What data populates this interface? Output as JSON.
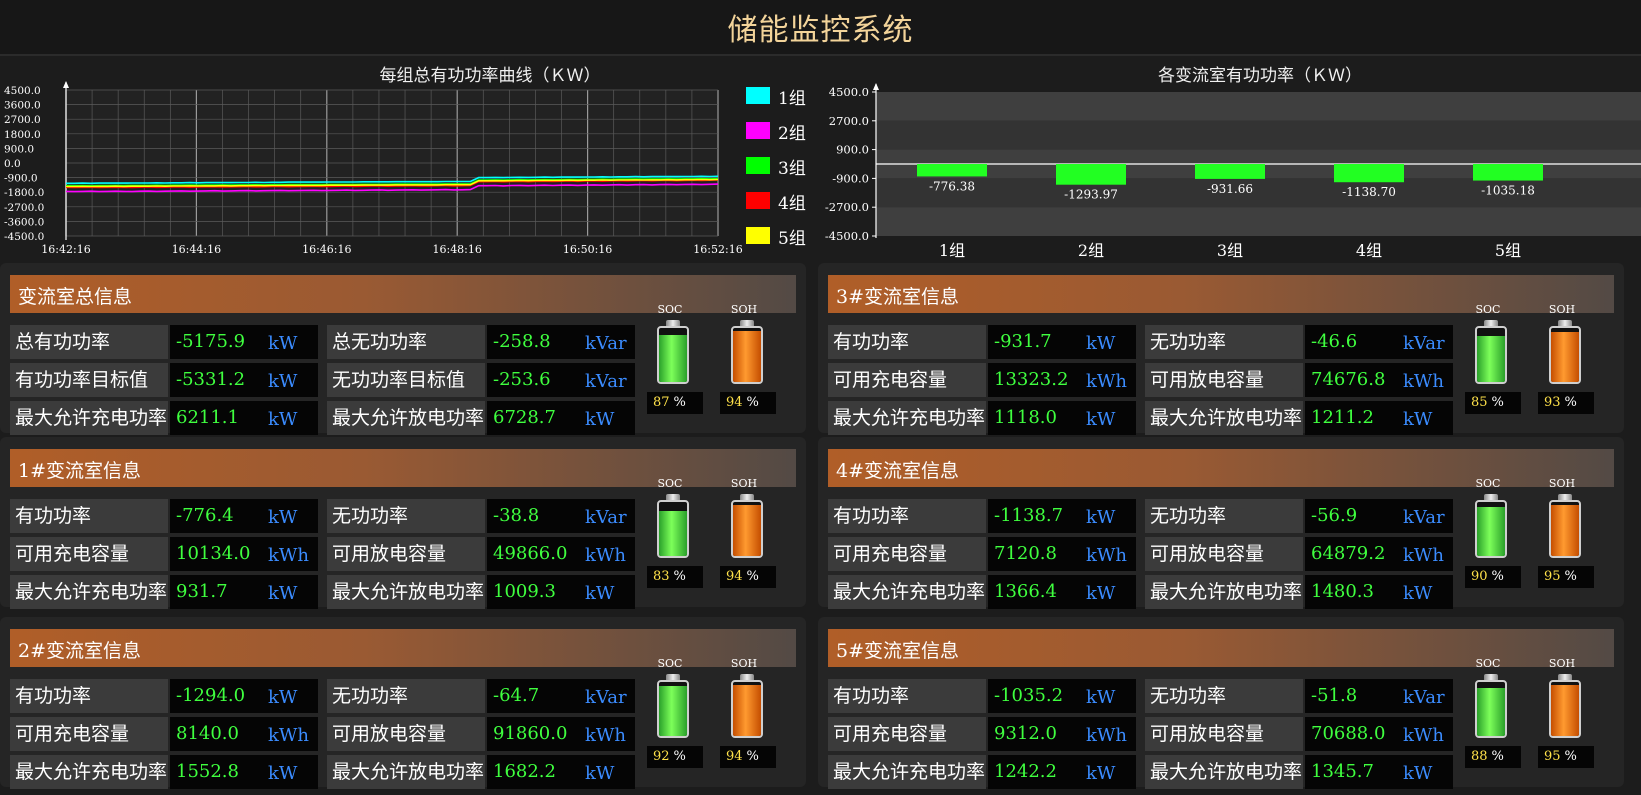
{
  "app_title": "储能监控系统",
  "line_chart": {
    "title": "每组总有功功率曲线（ＫＷ）",
    "legend": [
      {
        "label": "1组",
        "color": "#00ffff"
      },
      {
        "label": "2组",
        "color": "#ff00ff"
      },
      {
        "label": "3组",
        "color": "#00ff00"
      },
      {
        "label": "4组",
        "color": "#ff0000"
      },
      {
        "label": "5组",
        "color": "#ffff00"
      }
    ]
  },
  "bar_chart": {
    "title": "各变流室有功功率（ＫＷ）"
  },
  "chart_data": [
    {
      "type": "line",
      "title": "每组总有功功率曲线（ＫＷ）",
      "x_ticks": [
        "16:42:16",
        "16:44:16",
        "16:46:16",
        "16:48:16",
        "16:50:16",
        "16:52:16"
      ],
      "y_ticks": [
        "4500.0",
        "3600.0",
        "2700.0",
        "1800.0",
        "900.0",
        "0.0",
        "-900.0",
        "-1800.0",
        "-2700.0",
        "-3600.0",
        "-4500.0"
      ],
      "ylim": [
        -4500,
        4500
      ],
      "series": [
        {
          "name": "1组",
          "color": "#00ffff",
          "values": [
            -1250,
            -1250,
            -1240,
            -1250,
            -1240,
            -1240,
            -1230,
            -1240,
            -1230,
            -1230,
            -1230,
            -1220,
            -1230,
            -1220,
            -1220,
            -1210,
            -1220,
            -1210,
            -1210,
            -1200,
            -1210,
            -1200,
            -1200,
            -1190,
            -1200,
            -1190,
            -1190,
            -1180,
            -1180,
            -1180,
            -1180,
            -1180,
            -1170,
            -1170,
            -1170,
            -1170,
            -1160,
            -1160,
            -1160,
            -1160,
            -1150,
            -1150,
            -1150,
            -1150,
            -1150,
            -1150,
            -1140,
            -1140,
            -1140,
            -1140,
            -900,
            -900,
            -890,
            -900,
            -890,
            -880,
            -890,
            -880,
            -870,
            -880,
            -870,
            -860,
            -870,
            -860,
            -860,
            -850,
            -860,
            -850,
            -850,
            -840,
            -850,
            -840,
            -840,
            -830,
            -840,
            -830,
            -830,
            -820,
            -830,
            -820
          ]
        },
        {
          "name": "2组",
          "color": "#ff00ff",
          "values": [
            -1750,
            -1760,
            -1750,
            -1740,
            -1760,
            -1750,
            -1740,
            -1750,
            -1760,
            -1740,
            -1730,
            -1750,
            -1740,
            -1730,
            -1720,
            -1740,
            -1730,
            -1720,
            -1710,
            -1730,
            -1720,
            -1710,
            -1700,
            -1720,
            -1710,
            -1700,
            -1690,
            -1710,
            -1700,
            -1690,
            -1680,
            -1700,
            -1690,
            -1680,
            -1670,
            -1690,
            -1680,
            -1670,
            -1660,
            -1680,
            -1670,
            -1660,
            -1650,
            -1670,
            -1660,
            -1650,
            -1640,
            -1660,
            -1650,
            -1640,
            -1400,
            -1400,
            -1390,
            -1410,
            -1390,
            -1380,
            -1400,
            -1380,
            -1370,
            -1390,
            -1370,
            -1360,
            -1380,
            -1360,
            -1350,
            -1370,
            -1350,
            -1340,
            -1360,
            -1340,
            -1330,
            -1350,
            -1330,
            -1320,
            -1340,
            -1320,
            -1310,
            -1330,
            -1310,
            -1300
          ]
        },
        {
          "name": "3组",
          "color": "#00ff00",
          "values": [
            -1400,
            -1400,
            -1390,
            -1400,
            -1390,
            -1390,
            -1380,
            -1390,
            -1380,
            -1380,
            -1380,
            -1370,
            -1380,
            -1370,
            -1370,
            -1360,
            -1370,
            -1360,
            -1360,
            -1350,
            -1360,
            -1350,
            -1350,
            -1340,
            -1350,
            -1340,
            -1340,
            -1330,
            -1330,
            -1330,
            -1330,
            -1330,
            -1320,
            -1320,
            -1320,
            -1320,
            -1310,
            -1310,
            -1310,
            -1310,
            -1300,
            -1300,
            -1300,
            -1300,
            -1300,
            -1300,
            -1290,
            -1290,
            -1290,
            -1290,
            -1050,
            -1050,
            -1040,
            -1050,
            -1040,
            -1030,
            -1040,
            -1030,
            -1020,
            -1030,
            -1020,
            -1010,
            -1020,
            -1010,
            -1010,
            -1000,
            -1010,
            -1000,
            -1000,
            -990,
            -1000,
            -990,
            -990,
            -980,
            -990,
            -980,
            -980,
            -970,
            -980,
            -970
          ]
        },
        {
          "name": "4组",
          "color": "#ff0000",
          "values": [
            -1500,
            -1510,
            -1500,
            -1490,
            -1510,
            -1500,
            -1490,
            -1500,
            -1510,
            -1490,
            -1480,
            -1500,
            -1490,
            -1480,
            -1470,
            -1490,
            -1480,
            -1470,
            -1460,
            -1480,
            -1470,
            -1460,
            -1450,
            -1470,
            -1460,
            -1450,
            -1440,
            -1460,
            -1450,
            -1440,
            -1430,
            -1450,
            -1440,
            -1430,
            -1420,
            -1440,
            -1430,
            -1420,
            -1410,
            -1430,
            -1420,
            -1410,
            -1400,
            -1420,
            -1410,
            -1400,
            -1390,
            -1410,
            -1400,
            -1390,
            -1150,
            -1150,
            -1140,
            -1160,
            -1140,
            -1130,
            -1150,
            -1130,
            -1120,
            -1140,
            -1120,
            -1110,
            -1130,
            -1110,
            -1100,
            -1120,
            -1100,
            -1090,
            -1110,
            -1090,
            -1080,
            -1100,
            -1080,
            -1070,
            -1090,
            -1070,
            -1060,
            -1080,
            -1060,
            -1050
          ]
        },
        {
          "name": "5组",
          "color": "#ffff00",
          "values": [
            -1450,
            -1450,
            -1440,
            -1450,
            -1440,
            -1440,
            -1430,
            -1440,
            -1430,
            -1430,
            -1430,
            -1420,
            -1430,
            -1420,
            -1420,
            -1410,
            -1420,
            -1410,
            -1410,
            -1400,
            -1410,
            -1400,
            -1400,
            -1390,
            -1400,
            -1390,
            -1390,
            -1380,
            -1380,
            -1380,
            -1380,
            -1380,
            -1370,
            -1370,
            -1370,
            -1370,
            -1360,
            -1360,
            -1360,
            -1360,
            -1350,
            -1350,
            -1350,
            -1350,
            -1350,
            -1350,
            -1340,
            -1340,
            -1340,
            -1340,
            -1100,
            -1100,
            -1090,
            -1100,
            -1090,
            -1080,
            -1090,
            -1080,
            -1070,
            -1080,
            -1070,
            -1060,
            -1070,
            -1060,
            -1060,
            -1050,
            -1060,
            -1050,
            -1050,
            -1040,
            -1050,
            -1040,
            -1040,
            -1030,
            -1040,
            -1030,
            -1030,
            -1020,
            -1030,
            -1020
          ]
        }
      ]
    },
    {
      "type": "bar",
      "title": "各变流室有功功率（ＫＷ）",
      "categories": [
        "1组",
        "2组",
        "3组",
        "4组",
        "5组"
      ],
      "values": [
        -776.38,
        -1293.97,
        -931.66,
        -1138.7,
        -1035.18
      ],
      "value_labels": [
        "-776.38",
        "-1293.97",
        "-931.66",
        "-1138.70",
        "-1035.18"
      ],
      "y_ticks": [
        "4500.0",
        "2700.0",
        "900.0",
        "-900.0",
        "-2700.0",
        "-4500.0"
      ],
      "ylim": [
        -4500,
        4500
      ],
      "bar_color": "#22ff22"
    }
  ],
  "panels": [
    {
      "title": "变流室总信息",
      "rows": [
        {
          "l_label": "总有功功率",
          "l_value": "-5175.9",
          "l_unit": "kW",
          "r_label": "总无功功率",
          "r_value": "-258.8",
          "r_unit": "kVar"
        },
        {
          "l_label": "有功功率目标值",
          "l_value": "-5331.2",
          "l_unit": "kW",
          "r_label": "无功功率目标值",
          "r_value": "-253.6",
          "r_unit": "kVar"
        },
        {
          "l_label": "最大允许充电功率",
          "l_value": "6211.1",
          "l_unit": "kW",
          "r_label": "最大允许放电功率",
          "r_value": "6728.7",
          "r_unit": "kW"
        }
      ],
      "soc_label": "SOC",
      "soc": "87",
      "soh_label": "SOH",
      "soh": "94",
      "pct": "%"
    },
    {
      "title": "3#变流室信息",
      "rows": [
        {
          "l_label": "有功功率",
          "l_value": "-931.7",
          "l_unit": "kW",
          "r_label": "无功功率",
          "r_value": "-46.6",
          "r_unit": "kVar"
        },
        {
          "l_label": "可用充电容量",
          "l_value": "13323.2",
          "l_unit": "kWh",
          "r_label": "可用放电容量",
          "r_value": "74676.8",
          "r_unit": "kWh"
        },
        {
          "l_label": "最大允许充电功率",
          "l_value": "1118.0",
          "l_unit": "kW",
          "r_label": "最大允许放电功率",
          "r_value": "1211.2",
          "r_unit": "kW"
        }
      ],
      "soc_label": "SOC",
      "soc": "85",
      "soh_label": "SOH",
      "soh": "93",
      "pct": "%"
    },
    {
      "title": "1#变流室信息",
      "rows": [
        {
          "l_label": "有功功率",
          "l_value": "-776.4",
          "l_unit": "kW",
          "r_label": "无功功率",
          "r_value": "-38.8",
          "r_unit": "kVar"
        },
        {
          "l_label": "可用充电容量",
          "l_value": "10134.0",
          "l_unit": "kWh",
          "r_label": "可用放电容量",
          "r_value": "49866.0",
          "r_unit": "kWh"
        },
        {
          "l_label": "最大允许充电功率",
          "l_value": "931.7",
          "l_unit": "kW",
          "r_label": "最大允许放电功率",
          "r_value": "1009.3",
          "r_unit": "kW"
        }
      ],
      "soc_label": "SOC",
      "soc": "83",
      "soh_label": "SOH",
      "soh": "94",
      "pct": "%"
    },
    {
      "title": "4#变流室信息",
      "rows": [
        {
          "l_label": "有功功率",
          "l_value": "-1138.7",
          "l_unit": "kW",
          "r_label": "无功功率",
          "r_value": "-56.9",
          "r_unit": "kVar"
        },
        {
          "l_label": "可用充电容量",
          "l_value": "7120.8",
          "l_unit": "kWh",
          "r_label": "可用放电容量",
          "r_value": "64879.2",
          "r_unit": "kWh"
        },
        {
          "l_label": "最大允许充电功率",
          "l_value": "1366.4",
          "l_unit": "kW",
          "r_label": "最大允许放电功率",
          "r_value": "1480.3",
          "r_unit": "kW"
        }
      ],
      "soc_label": "SOC",
      "soc": "90",
      "soh_label": "SOH",
      "soh": "95",
      "pct": "%"
    },
    {
      "title": "2#变流室信息",
      "rows": [
        {
          "l_label": "有功功率",
          "l_value": "-1294.0",
          "l_unit": "kW",
          "r_label": "无功功率",
          "r_value": "-64.7",
          "r_unit": "kVar"
        },
        {
          "l_label": "可用充电容量",
          "l_value": "8140.0",
          "l_unit": "kWh",
          "r_label": "可用放电容量",
          "r_value": "91860.0",
          "r_unit": "kWh"
        },
        {
          "l_label": "最大允许充电功率",
          "l_value": "1552.8",
          "l_unit": "kW",
          "r_label": "最大允许放电功率",
          "r_value": "1682.2",
          "r_unit": "kW"
        }
      ],
      "soc_label": "SOC",
      "soc": "92",
      "soh_label": "SOH",
      "soh": "94",
      "pct": "%"
    },
    {
      "title": "5#变流室信息",
      "rows": [
        {
          "l_label": "有功功率",
          "l_value": "-1035.2",
          "l_unit": "kW",
          "r_label": "无功功率",
          "r_value": "-51.8",
          "r_unit": "kVar"
        },
        {
          "l_label": "可用充电容量",
          "l_value": "9312.0",
          "l_unit": "kWh",
          "r_label": "可用放电容量",
          "r_value": "70688.0",
          "r_unit": "kWh"
        },
        {
          "l_label": "最大允许充电功率",
          "l_value": "1242.2",
          "l_unit": "kW",
          "r_label": "最大允许放电功率",
          "r_value": "1345.7",
          "r_unit": "kW"
        }
      ],
      "soc_label": "SOC",
      "soc": "88",
      "soh_label": "SOH",
      "soh": "95",
      "pct": "%"
    }
  ]
}
